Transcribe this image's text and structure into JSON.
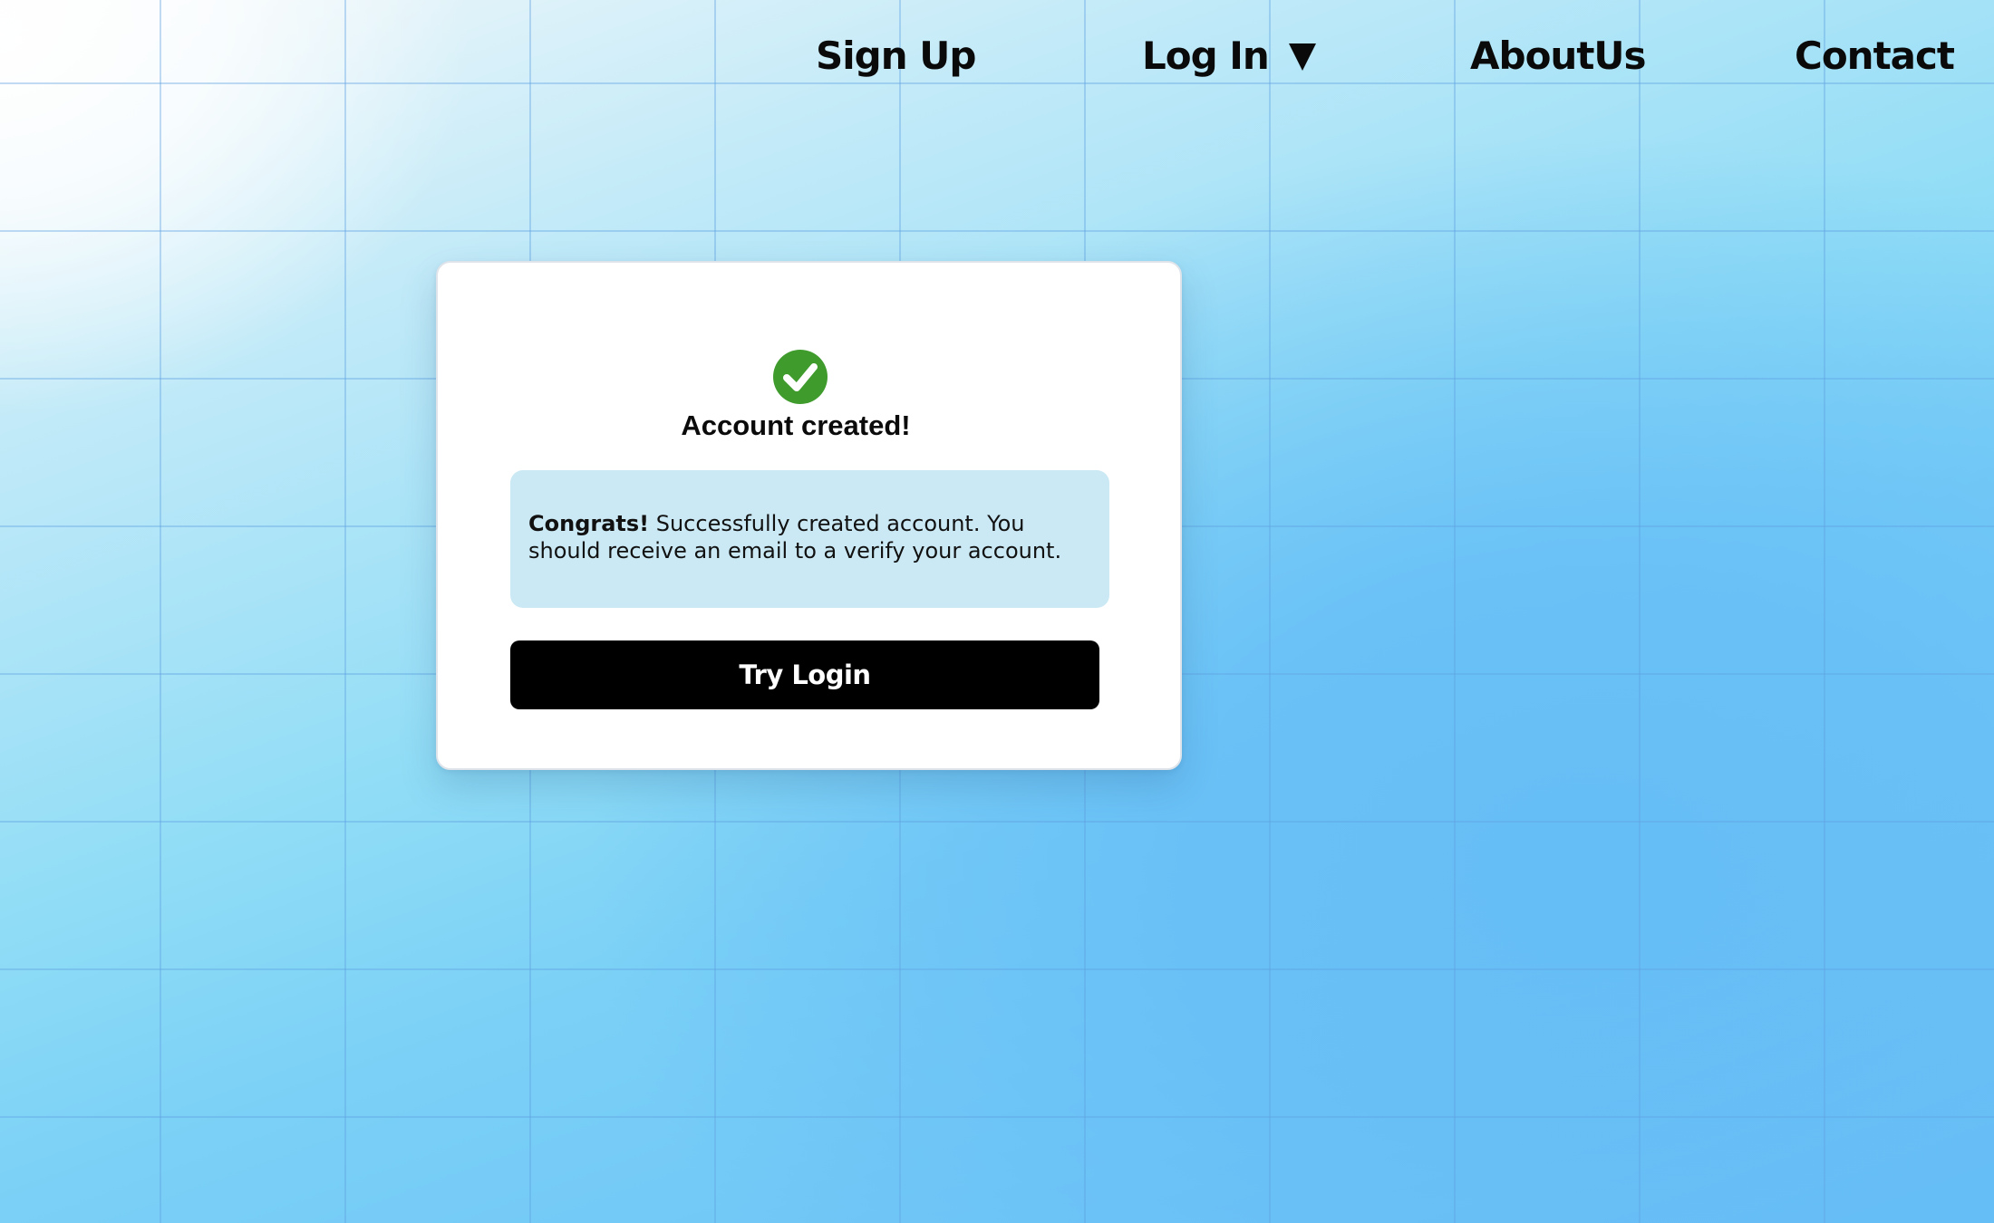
{
  "nav": {
    "items": [
      {
        "label": "Sign Up"
      },
      {
        "label": "Log In",
        "icon": "caret-down-icon"
      },
      {
        "label": "AboutUs"
      },
      {
        "label": "Contact"
      }
    ]
  },
  "modal": {
    "icon": "check-circle-icon",
    "icon_color": "#3e9b2c",
    "title": "Account created!",
    "alert": {
      "bold_text": "Congrats!",
      "text": " Successfully created account. You should receive an email to a verify your account."
    },
    "button_label": "Try Login"
  },
  "colors": {
    "button_bg": "#000000",
    "alert_bg": "#cbe9f4",
    "background_accent": "#66bdf6"
  }
}
